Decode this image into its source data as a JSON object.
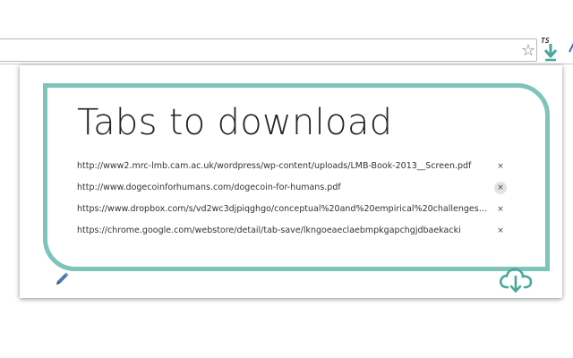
{
  "toolbar": {
    "star_glyph": "☆",
    "extension_badge": "TS",
    "extension_icon": "download-arrow-icon"
  },
  "popup": {
    "title": "Tabs to download",
    "accent_color": "#7dc4ba",
    "tabs": [
      {
        "url": "http://www2.mrc-lmb.cam.ac.uk/wordpress/wp-content/uploads/LMB-Book-2013__Screen.pdf",
        "close": "×"
      },
      {
        "url": "http://www.dogecoinforhumans.com/dogecoin-for-humans.pdf",
        "close": "×"
      },
      {
        "url": "https://www.dropbox.com/s/vd2wc3djpiqghgo/conceptual%20and%20empirical%20challenges%2...",
        "close": "×"
      },
      {
        "url": "https://chrome.google.com/webstore/detail/tab-save/lkngoeaeclaebmpkgapchgjdbaekacki",
        "close": "×"
      }
    ],
    "edit_icon": "pencil-icon",
    "download_icon": "cloud-download-icon"
  }
}
